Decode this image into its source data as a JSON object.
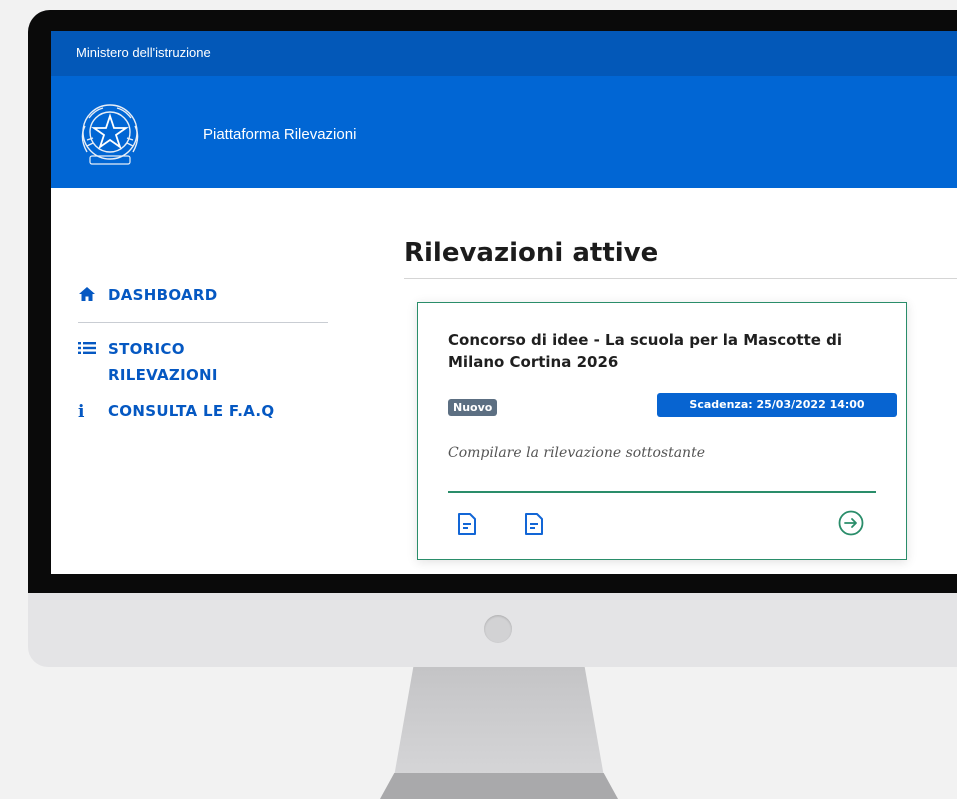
{
  "topbar": {
    "label": "Ministero dell'istruzione"
  },
  "header": {
    "emblem_icon": "italian-republic-emblem",
    "title": "Piattaforma Rilevazioni"
  },
  "sidebar": {
    "items": [
      {
        "icon": "home-icon",
        "label": "DASHBOARD"
      },
      {
        "icon": "list-icon",
        "label": "STORICO RILEVAZIONI"
      },
      {
        "icon": "info-icon",
        "label": "CONSULTA LE F.A.Q"
      }
    ]
  },
  "main": {
    "title": "Rilevazioni attive",
    "card": {
      "title": "Concorso di idee - La scuola per la Mascotte di Milano Cortina 2026",
      "badge_new": "Nuovo",
      "deadline": "Scadenza: 25/03/2022 14:00",
      "subtitle": "Compilare la rilevazione sottostante",
      "icons": [
        "document-icon",
        "document-icon",
        "arrow-right-circle-icon"
      ]
    }
  },
  "colors": {
    "primary": "#0166d4",
    "topbar": "#0358b8",
    "accent_green": "#2a8d6a",
    "badge_grey": "#5c6f82"
  }
}
